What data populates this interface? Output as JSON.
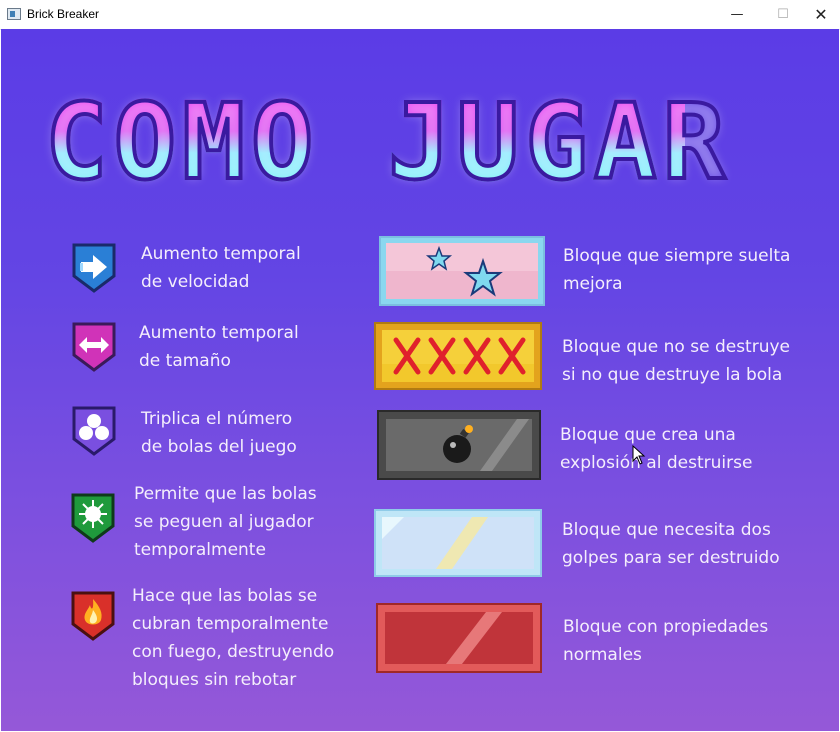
{
  "window": {
    "title": "Brick Breaker",
    "min": "—",
    "max": "☐",
    "close": "✕"
  },
  "heading": "COMO JUGAR",
  "powerups": [
    {
      "icon": "speed-arrow-icon",
      "color": "#2a7fd6",
      "text": "Aumento temporal\nde velocidad"
    },
    {
      "icon": "expand-arrows-icon",
      "color": "#d033b8",
      "text": "Aumento temporal\nde tamaño"
    },
    {
      "icon": "triple-balls-icon",
      "color": "#7a4fe0",
      "text": "Triplica el número\nde bolas del juego"
    },
    {
      "icon": "sticky-burst-icon",
      "color": "#1f9a3c",
      "text": "Permite que las bolas\nse peguen al jugador\ntemporalmente"
    },
    {
      "icon": "fire-icon",
      "color": "#d9302a",
      "text": "Hace que las bolas se\ncubran temporalmente\ncon fuego, destruyendo\nbloques sin rebotar"
    }
  ],
  "blocks": [
    {
      "icon": "star-block-icon",
      "text": "Bloque que siempre suelta\nmejora"
    },
    {
      "icon": "unbreakable-block-icon",
      "text": "Bloque que no se destruye\nsi no que destruye la bola"
    },
    {
      "icon": "bomb-block-icon",
      "text": "Bloque que crea una\nexplosión al destruirse"
    },
    {
      "icon": "ice-block-icon",
      "text": "Bloque que necesita dos\ngolpes para ser destruido"
    },
    {
      "icon": "red-block-icon",
      "text": "Bloque con propiedades\nnormales"
    }
  ]
}
